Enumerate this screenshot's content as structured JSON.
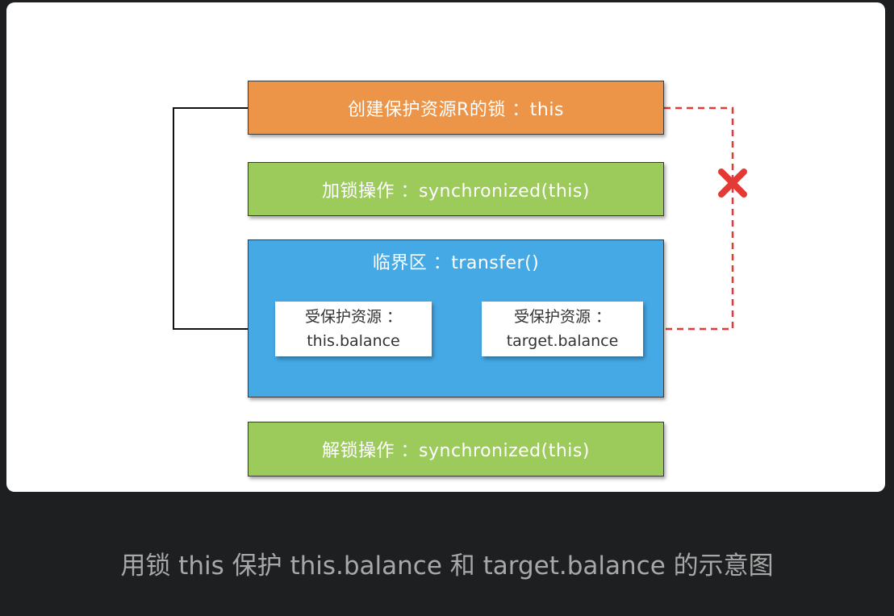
{
  "diagram": {
    "create_lock": "创建保护资源R的锁 ：this",
    "lock_op": "加锁操作 ：synchronized(this)",
    "critical_section": "临界区 ：transfer()",
    "resource_left": {
      "line1": "受保护资源 ：",
      "line2": "this.balance"
    },
    "resource_right": {
      "line1": "受保护资源 ：",
      "line2": "target.balance"
    },
    "unlock_op": "解锁操作 ：synchronized(this)"
  },
  "caption": "用锁 this 保护 this.balance 和 target.balance 的示意图",
  "colors": {
    "orange": "#ec9548",
    "green": "#9ccb5c",
    "blue": "#45a9e6",
    "red_dashed": "#e53935"
  }
}
